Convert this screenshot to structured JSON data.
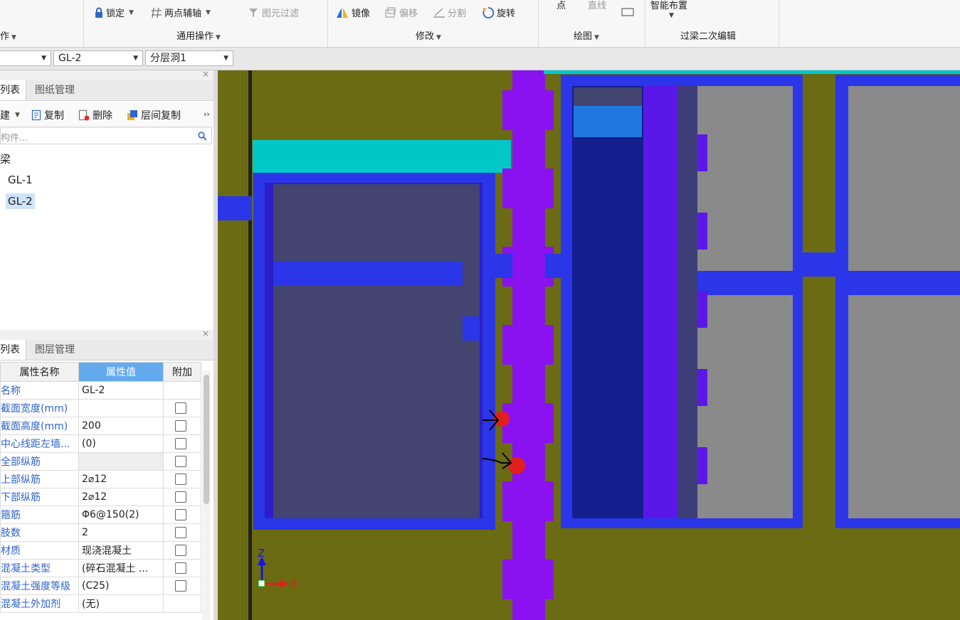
{
  "ribbon": {
    "lock": "锁定",
    "two_point_axis": "两点辅轴",
    "element_filter": "图元过滤",
    "mirror": "镜像",
    "offset": "偏移",
    "split": "分割",
    "rotate": "旋转",
    "point": "点",
    "line": "直线",
    "smart_layout": "智能布置",
    "group_ops_partial": "作",
    "group_general_ops": "通用操作",
    "group_modify": "修改",
    "group_draw": "绘图",
    "group_lintel_edit": "过梁二次编辑"
  },
  "combobar": {
    "combo1_value": "",
    "combo2_value": "GL-2",
    "combo3_value": "分层洞1"
  },
  "component_panel": {
    "tab_list": "列表",
    "tab_drawing_mgmt": "图纸管理",
    "new_label": "建",
    "copy_label": "复制",
    "delete_label": "删除",
    "floor_copy_label": "层间复制",
    "more": "››",
    "search_placeholder": "构件...",
    "tree_root": "梁",
    "tree_items": [
      "GL-1",
      "GL-2"
    ],
    "selected_item": "GL-2"
  },
  "property_panel": {
    "tab_list": "列表",
    "tab_layer_mgmt": "图层管理",
    "col_name": "属性名称",
    "col_value": "属性值",
    "col_extra": "附加",
    "rows": [
      {
        "name": "名称",
        "value": "GL-2",
        "checkbox": false
      },
      {
        "name": "截面宽度(mm)",
        "value": "",
        "checkbox": true
      },
      {
        "name": "截面高度(mm)",
        "value": "200",
        "checkbox": true
      },
      {
        "name": "中心线距左墙...",
        "value": "(0)",
        "checkbox": true
      },
      {
        "name": "全部纵筋",
        "value": "",
        "checkbox": true
      },
      {
        "name": "上部纵筋",
        "value": "2⌀12",
        "checkbox": true
      },
      {
        "name": "下部纵筋",
        "value": "2⌀12",
        "checkbox": true
      },
      {
        "name": "箍筋",
        "value": "Φ6@150(2)",
        "checkbox": true
      },
      {
        "name": "肢数",
        "value": "2",
        "checkbox": true
      },
      {
        "name": "材质",
        "value": "现浇混凝土",
        "checkbox": true
      },
      {
        "name": "混凝土类型",
        "value": "(碎石混凝土 ...",
        "checkbox": true
      },
      {
        "name": "混凝土强度等级",
        "value": "(C25)",
        "checkbox": true
      },
      {
        "name": "混凝土外加剂",
        "value": "(无)",
        "checkbox": false
      }
    ]
  },
  "viewport": {
    "axis_z": "Z",
    "axis_x": "X",
    "colors": {
      "ground": "#6b6b14",
      "wall": "#2a36e8",
      "column_purple": "#8a12f0",
      "lintel_cyan": "#00c8c8",
      "opening_grey": "#444470",
      "opening_light": "#8a8a8a",
      "marker_red": "#e02020"
    }
  },
  "icons": [
    "lock-icon",
    "axis-icon",
    "filter-icon",
    "mirror-icon",
    "offset-icon",
    "split-icon",
    "rotate-icon",
    "rect-icon",
    "copy-icon",
    "delete-icon",
    "floor-copy-icon",
    "search-icon",
    "close-icon"
  ]
}
